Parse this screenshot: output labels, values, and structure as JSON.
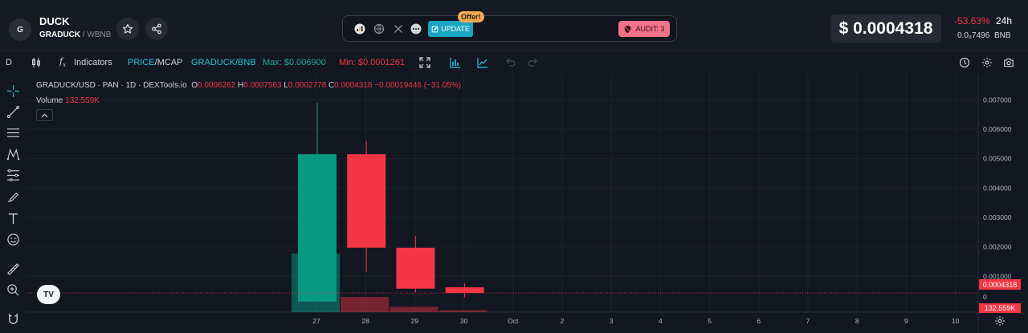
{
  "header": {
    "token_logo_letter": "G",
    "token_name": "DUCK",
    "pair_base": "GRADUCK",
    "pair_sep": "/",
    "pair_quote": "WBNB",
    "update_label": "UPDATE",
    "offer_label": "Offer!",
    "audit_label": "AUDIT: 3",
    "price": "$ 0.0004318",
    "change_24h": "-53.63%",
    "period": "24h",
    "bnb_value": "0.0₈7496",
    "bnb_label": "BNB"
  },
  "toolbar": {
    "interval": "D",
    "indicators_label": "Indicators",
    "price_label": "PRICE",
    "mcap_label": "MCAP",
    "pair_label": "GRADUCK/BNB",
    "max_label": "Max: $0.006900",
    "min_label": "Min: $0.0001261"
  },
  "legend": {
    "symbol": "GRADUCK/USD · PAN · 1D · DEXTools.io",
    "o": "0.0006262",
    "h": "0.0007563",
    "l": "0.0002778",
    "c": "0.0004318",
    "chg": "−0.00019446 (−31.05%)",
    "volume_label": "Volume",
    "volume_value": "132.559K"
  },
  "price_axis": {
    "last_price_tag": "0.0004318",
    "volume_tag": "132.559K",
    "volume_zero": "0"
  },
  "colors": {
    "up": "#089981",
    "down": "#f23645",
    "background": "#131722",
    "accent": "#26c6da"
  },
  "chart_data": {
    "type": "candlestick",
    "x_ticks": [
      "27",
      "28",
      "29",
      "30",
      "Oct",
      "2",
      "3",
      "4",
      "5",
      "6",
      "7",
      "8",
      "9",
      "10"
    ],
    "y_ticks": [
      "0.007000",
      "0.006000",
      "0.005000",
      "0.004000",
      "0.003000",
      "0.002000",
      "0.001000"
    ],
    "ylim": [
      0,
      0.0075
    ],
    "last_price": 0.0004318,
    "candles": [
      {
        "date": "27",
        "open": 0.00014,
        "high": 0.0069,
        "low": 0.00014,
        "close": 0.00515,
        "volume": 100
      },
      {
        "date": "28",
        "open": 0.00515,
        "high": 0.0056,
        "low": 0.00115,
        "close": 0.00197,
        "volume": 26
      },
      {
        "date": "29",
        "open": 0.00197,
        "high": 0.00237,
        "low": 0.00046,
        "close": 0.00058,
        "volume": 9
      },
      {
        "date": "30",
        "open": 0.0006262,
        "high": 0.0007563,
        "low": 0.0002778,
        "close": 0.0004318,
        "volume": 3
      }
    ]
  }
}
